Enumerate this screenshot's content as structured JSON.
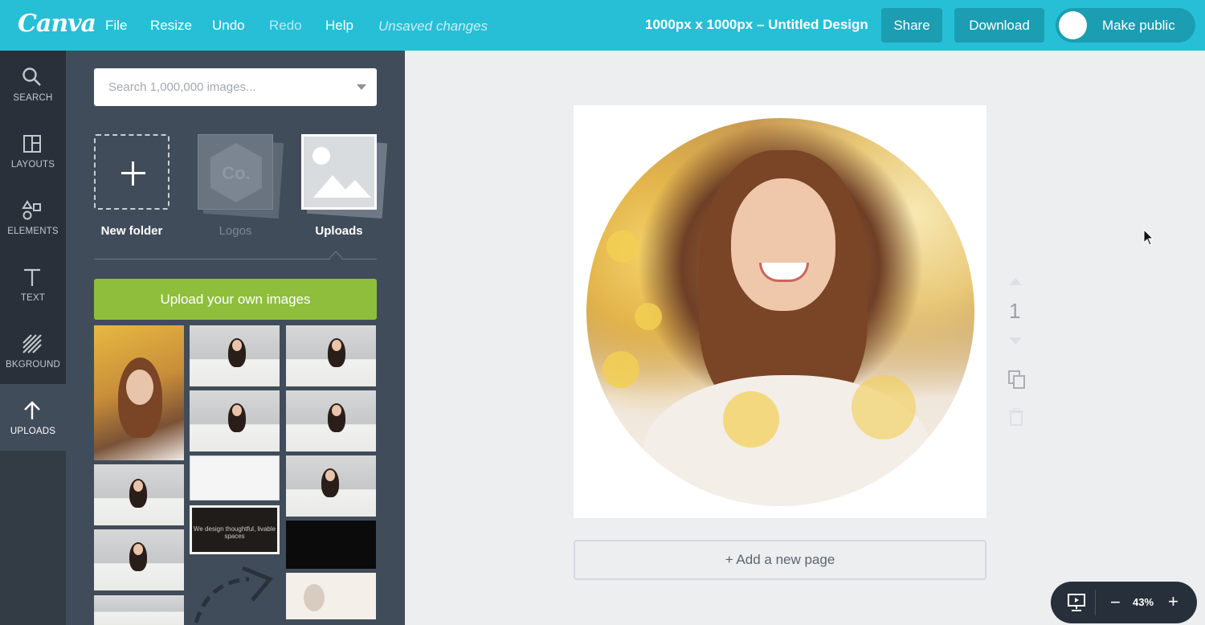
{
  "topbar": {
    "logo": "Canva",
    "menu": [
      {
        "label": "File"
      },
      {
        "label": "Resize"
      },
      {
        "label": "Undo"
      },
      {
        "label": "Redo"
      },
      {
        "label": "Help"
      }
    ],
    "status": "Unsaved changes",
    "document_title": "1000px x 1000px – Untitled Design",
    "share_label": "Share",
    "download_label": "Download",
    "public_label": "Make public",
    "accent_color": "#26bfd6"
  },
  "rail": {
    "items": [
      {
        "label": "SEARCH",
        "icon": "search-icon"
      },
      {
        "label": "LAYOUTS",
        "icon": "layouts-icon"
      },
      {
        "label": "ELEMENTS",
        "icon": "elements-icon"
      },
      {
        "label": "TEXT",
        "icon": "text-icon"
      },
      {
        "label": "BKGROUND",
        "icon": "background-icon"
      },
      {
        "label": "UPLOADS",
        "icon": "upload-arrow-icon",
        "active": true
      }
    ]
  },
  "panel": {
    "search_placeholder": "Search 1,000,000 images...",
    "folders": [
      {
        "label": "New folder"
      },
      {
        "label": "Logos",
        "icon_text": "Co."
      },
      {
        "label": "Uploads",
        "selected": true
      }
    ],
    "upload_button": "Upload your own images",
    "upload_button_color": "#8fbe3c",
    "thumb_text": "We design thoughtful, livable spaces"
  },
  "canvas": {
    "page_number": "1",
    "add_page_label": "+ Add a new page"
  },
  "zoom": {
    "level": "43%",
    "minus": "−",
    "plus": "+"
  }
}
